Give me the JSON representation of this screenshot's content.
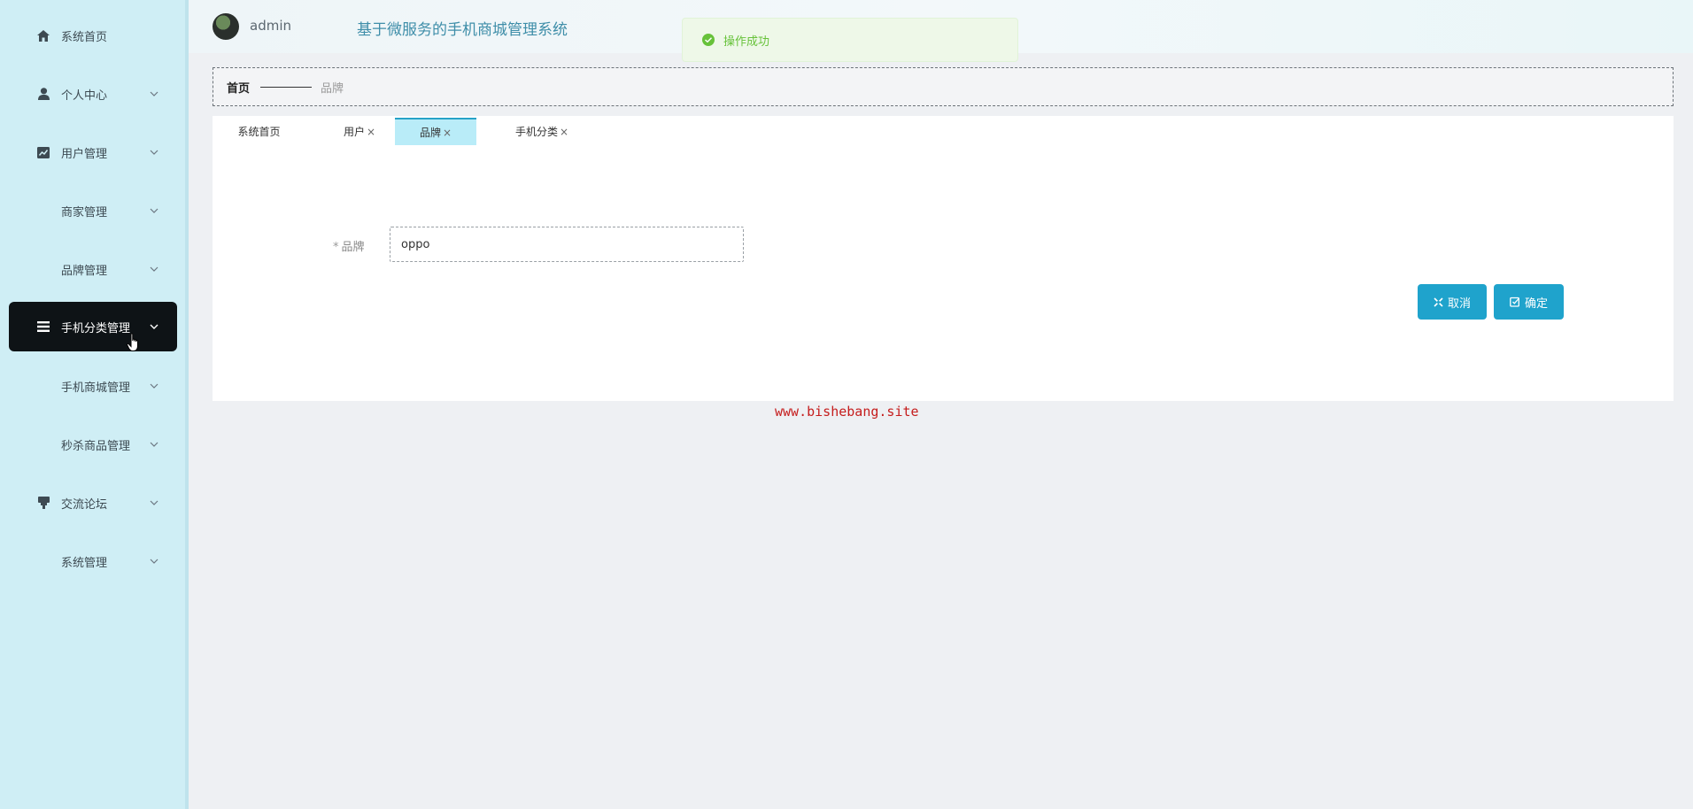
{
  "sidebar": {
    "items": [
      {
        "label": "系统首页",
        "icon": "home-icon",
        "chevron": false,
        "active": false
      },
      {
        "label": "个人中心",
        "icon": "user-icon",
        "chevron": true,
        "active": false
      },
      {
        "label": "用户管理",
        "icon": "chart-icon",
        "chevron": true,
        "active": false
      },
      {
        "label": "商家管理",
        "icon": "grid-icon",
        "chevron": true,
        "active": false
      },
      {
        "label": "品牌管理",
        "icon": "grid-icon",
        "chevron": true,
        "active": false
      },
      {
        "label": "手机分类管理",
        "icon": "list-icon",
        "chevron": true,
        "active": true
      },
      {
        "label": "手机商城管理",
        "icon": "grid-icon",
        "chevron": true,
        "active": false
      },
      {
        "label": "秒杀商品管理",
        "icon": "grid-icon",
        "chevron": true,
        "active": false
      },
      {
        "label": "交流论坛",
        "icon": "forum-icon",
        "chevron": true,
        "active": false
      },
      {
        "label": "系统管理",
        "icon": "grid-icon",
        "chevron": true,
        "active": false
      }
    ]
  },
  "header": {
    "username": "admin",
    "title": "基于微服务的手机商城管理系统"
  },
  "toast": {
    "message": "操作成功",
    "icon": "check-circle-icon",
    "color": "#67c23a"
  },
  "breadcrumb": {
    "home": "首页",
    "current": "品牌"
  },
  "tabs": [
    {
      "label": "系统首页",
      "closable": false,
      "active": false
    },
    {
      "label": "用户",
      "closable": true,
      "active": false
    },
    {
      "label": "品牌",
      "closable": true,
      "active": true
    },
    {
      "label": "手机分类",
      "closable": true,
      "active": false
    }
  ],
  "form": {
    "required_mark": "*",
    "brand_label": "品牌",
    "brand_value": "oppo"
  },
  "buttons": {
    "cancel": "取消",
    "confirm": "确定"
  },
  "watermark": "www.bishebang.site",
  "colors": {
    "sidebar_bg": "#cfeef5",
    "active_menu": "#0e1316",
    "accent": "#1fa3cc",
    "title": "#3f8ea9",
    "success": "#67c23a"
  }
}
